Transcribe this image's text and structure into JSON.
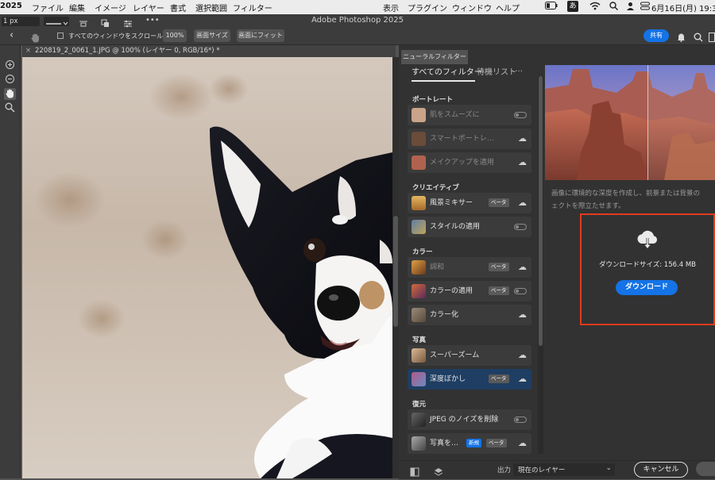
{
  "menubar": {
    "app": "2025",
    "items": [
      "ファイル",
      "編集",
      "イメージ",
      "レイヤー",
      "書式",
      "選択範囲",
      "フィルター",
      "表示",
      "プラグイン",
      "ウィンドウ",
      "ヘルプ"
    ],
    "ime": "あ",
    "clock": "6月16日(月)  19:32"
  },
  "window": {
    "title": "Adobe Photoshop 2025"
  },
  "options": {
    "brush_size": "1 px",
    "scroll_all_label": "すべてのウィンドウをスクロール",
    "zoom_100": "100%",
    "fit_screen": "画面サイズ",
    "fill_screen": "画面にフィット",
    "share": "共有"
  },
  "document": {
    "tab_title": "220819_2_0061_1.JPG @ 100% (レイヤー 0, RGB/16*) *"
  },
  "neural": {
    "panel_title": "ニューラルフィルター",
    "tabs": [
      "すべてのフィルター",
      "待機リスト",
      "…"
    ],
    "categories": [
      {
        "label": "ポートレート",
        "items": [
          {
            "label": "肌をスムーズに",
            "control": "toggle",
            "dim": true,
            "thumb": "#c9a48a"
          },
          {
            "label": "スマートポートレ…",
            "control": "cloud",
            "dim": true,
            "thumb": "#6b4b3a"
          },
          {
            "label": "メイクアップを適用",
            "control": "cloud",
            "dim": true,
            "thumb": "#b0624e"
          }
        ]
      },
      {
        "label": "クリエイティブ",
        "items": [
          {
            "label": "風景ミキサー",
            "badge": "ベータ",
            "control": "cloud",
            "thumb": "#d9a24a"
          },
          {
            "label": "スタイルの適用",
            "control": "toggle",
            "thumb": "#5e7fa6"
          }
        ]
      },
      {
        "label": "カラー",
        "items": [
          {
            "label": "調和",
            "badge": "ベータ",
            "control": "cloud",
            "dim": true,
            "thumb": "#e0a044"
          },
          {
            "label": "カラーの適用",
            "badge": "ベータ",
            "control": "toggle",
            "thumb": "#d36a3c"
          },
          {
            "label": "カラー化",
            "control": "cloud",
            "thumb": "#9a8a7a"
          }
        ]
      },
      {
        "label": "写真",
        "items": [
          {
            "label": "スーパーズーム",
            "control": "cloud",
            "thumb": "#b98d6c"
          },
          {
            "label": "深度ぼかし",
            "badge": "ベータ",
            "control": "cloud",
            "selected": true,
            "thumb": "#b25a8c"
          }
        ]
      },
      {
        "label": "復元",
        "items": [
          {
            "label": "JPEG のノイズを削除",
            "control": "toggle",
            "thumb": "#444444"
          },
          {
            "label": "写真を…",
            "badge_new": "新規",
            "badge": "ベータ",
            "control": "cloud",
            "thumb": "#8a8a8a"
          }
        ]
      }
    ],
    "description_lines": [
      "画像に環境的な深度を作成し、前景または背景の",
      "ェクトを際立たせます。"
    ],
    "download": {
      "size_text": "ダウンロードサイズ: 156.4 MB",
      "button": "ダウンロード"
    },
    "bottom": {
      "output_label": "出力",
      "output_value": "現在のレイヤー",
      "cancel": "キャンセル"
    }
  }
}
